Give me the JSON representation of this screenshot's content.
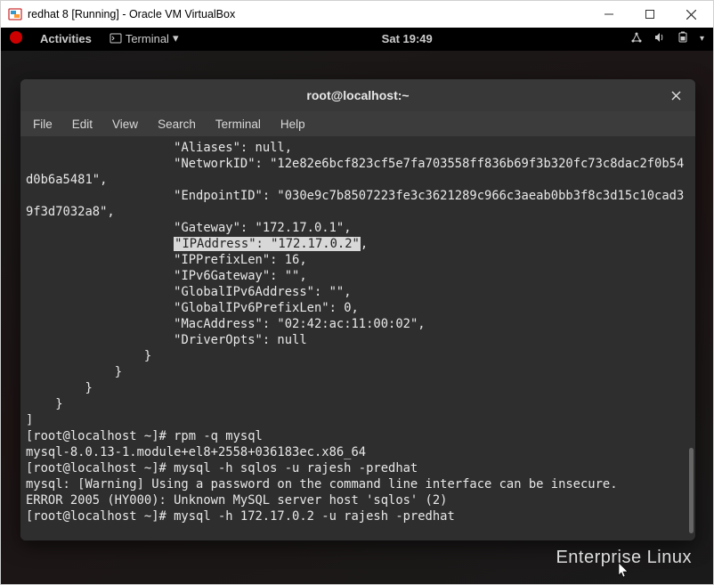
{
  "vbox": {
    "title": "redhat 8 [Running] - Oracle VM VirtualBox"
  },
  "gnome": {
    "activities": "Activities",
    "app_label": "Terminal",
    "clock": "Sat 19:49"
  },
  "terminal": {
    "title": "root@localhost:~",
    "menu": {
      "file": "File",
      "edit": "Edit",
      "view": "View",
      "search": "Search",
      "terminal": "Terminal",
      "help": "Help"
    },
    "output": {
      "lines_before_highlight": "                    \"Aliases\": null,\n                    \"NetworkID\": \"12e82e6bcf823cf5e7fa703558ff836b69f3b320fc73c8dac2f0b54d0b6a5481\",\n                    \"EndpointID\": \"030e9c7b8507223fe3c3621289c966c3aeab0bb3f8c3d15c10cad39f3d7032a8\",\n                    \"Gateway\": \"172.17.0.1\",\n                    ",
      "highlighted": "\"IPAddress\": \"172.17.0.2\"",
      "after_highlight_comma": ",",
      "lines_after_highlight": "                    \"IPPrefixLen\": 16,\n                    \"IPv6Gateway\": \"\",\n                    \"GlobalIPv6Address\": \"\",\n                    \"GlobalIPv6PrefixLen\": 0,\n                    \"MacAddress\": \"02:42:ac:11:00:02\",\n                    \"DriverOpts\": null\n                }\n            }\n        }\n    }\n]\n[root@localhost ~]# rpm -q mysql\nmysql-8.0.13-1.module+el8+2558+036183ec.x86_64\n[root@localhost ~]# mysql -h sqlos -u rajesh -predhat\nmysql: [Warning] Using a password on the command line interface can be insecure.\nERROR 2005 (HY000): Unknown MySQL server host 'sqlos' (2)\n[root@localhost ~]# mysql -h 172.17.0.2 -u rajesh -predhat"
    }
  },
  "desktop": {
    "footer_label": "Enterprise Linux"
  }
}
